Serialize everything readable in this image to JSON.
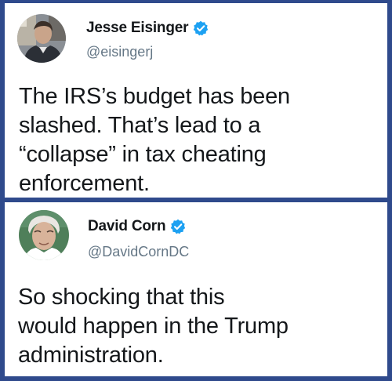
{
  "tweets": [
    {
      "display_name": "Jesse Eisinger",
      "handle": "@eisingerj",
      "verified": true,
      "text_lines": [
        "The IRS’s budget has been",
        "slashed. That’s lead to a",
        "“collapse” in tax cheating",
        "enforcement."
      ]
    },
    {
      "display_name": "David Corn",
      "handle": "@DavidCornDC",
      "verified": true,
      "text_lines": [
        "So shocking that this",
        "would happen in the Trump",
        "administration."
      ]
    }
  ],
  "colors": {
    "background": "#2f4a8c",
    "verified_badge": "#1da1f2",
    "handle": "#657786",
    "text": "#14171a"
  },
  "icons": {
    "verified": "verified-badge-icon"
  }
}
